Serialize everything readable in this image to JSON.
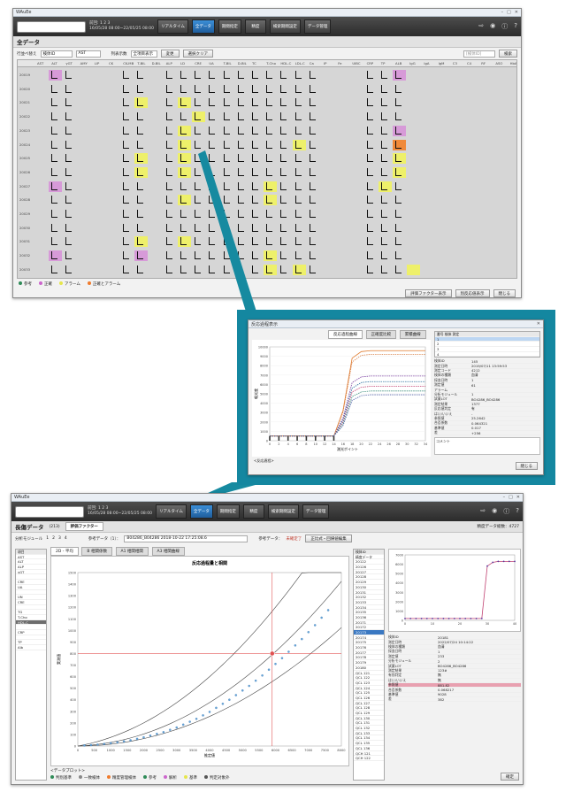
{
  "app": {
    "title": "WAuEe",
    "toolbar": {
      "date_line1": "前回: 1 2 3",
      "date_line2": "16/05/28 08:00~22/05/25 08:00",
      "buttons": [
        "リアルタイム",
        "全データ",
        "期間指定",
        "精度",
        "検索期間設定",
        "データ管理"
      ],
      "icons": [
        "exit-icon",
        "camera-icon",
        "info-icon",
        "help-icon"
      ]
    }
  },
  "top_window": {
    "section_title": "全データ",
    "controls": {
      "sort_label": "行並べ替え",
      "sort_value": "検体ID",
      "sort_sub": "AST",
      "display_label": "列表示数",
      "display_value": "全項目表示",
      "change_button": "変更",
      "clear_button": "選択クリア",
      "search_placeholder": "[検体ID]",
      "search_button": "検索"
    },
    "columns": [
      "AST",
      "ALT",
      "γGT",
      "AMY",
      "LIP",
      "CK",
      "CK-MB",
      "T-BIL",
      "D-BIL",
      "ALP",
      "LD",
      "CRE",
      "UA",
      "T-BIL",
      "D-BIL",
      "TC",
      "T-Cho",
      "HDL-C",
      "LDL-C",
      "Ca",
      "IP",
      "Fe",
      "UIBC",
      "CRP",
      "TP",
      "ALB",
      "IgG",
      "IgA",
      "IgM",
      "C3",
      "C4",
      "RF",
      "ASO",
      "HbA1c"
    ],
    "rows": [
      "20019",
      "20020",
      "20021",
      "20022",
      "20023",
      "20024",
      "20025",
      "20026",
      "20027",
      "20028",
      "20029",
      "20030",
      "20031",
      "20032",
      "20033"
    ],
    "legend": [
      "参考",
      "正確",
      "アラーム",
      "正確とアラーム"
    ],
    "bottom_buttons": [
      "評価ファクター表示",
      "別反応値表示",
      "閉じる"
    ]
  },
  "popup": {
    "title": "反応過程表示",
    "tabs": [
      "反応過程曲線",
      "正確度比較",
      "累積曲線"
    ],
    "chart_title": "",
    "xlabel": "測光ポイント",
    "ylabel": "吸光度",
    "curve_note": "<反応過程>",
    "close_button": "閉じる",
    "fields": [
      [
        "検体ID",
        "145"
      ],
      [
        "測定日時",
        "2019/07/11 13:59:53"
      ],
      [
        "測定コード",
        "4212"
      ],
      [
        "検体の種類",
        "血清"
      ],
      [
        "採血日時",
        "1"
      ],
      [
        "測定値",
        "61"
      ],
      [
        "アラーム",
        ""
      ],
      [
        "分析モジュール",
        "1"
      ],
      [
        "試薬LOT",
        "BO4286_BO4286"
      ],
      [
        "測定結果",
        "1377"
      ],
      [
        "反応値判定",
        "有"
      ],
      [
        "はい/いいえ",
        "-"
      ],
      [
        "参照値",
        "25.2642"
      ],
      [
        "合否係数",
        "0.064321"
      ],
      [
        "基準値",
        "0.017"
      ],
      [
        "差",
        "+256"
      ]
    ],
    "list_header": [
      "番号",
      "検体",
      "測定"
    ],
    "list_items": [
      "1",
      "2",
      "3",
      "4",
      "5",
      "6",
      "7",
      "8",
      "9",
      "10",
      "11",
      "12"
    ],
    "comment_label": "コメント",
    "ok_button": "確定"
  },
  "bottom_window": {
    "section_title": "長傷データ",
    "count_label": "(213)",
    "tab_label": "評価ファクター",
    "right_info": "精度データ総数：4727",
    "module_label": "分析モジュール",
    "module_values": [
      "1",
      "2",
      "3",
      "4"
    ],
    "ref_label": "参考データ（1）：",
    "ref_value": "B04286_B04286 2018-10-22 17:25:08.6",
    "ref_status_label": "参考データ：",
    "ref_status": "未確定了",
    "register_button": "正比式・回帰値編集",
    "items_header": "項目",
    "items": [
      "AST",
      "ALT",
      "ALP",
      "γGT",
      "",
      "CRE",
      "UA",
      "",
      "UN",
      "CRE",
      "",
      "TG",
      "T-Cho",
      "HDL-C",
      "",
      "CRP",
      "",
      "TP",
      "Alb"
    ],
    "graph_tabs": [
      "2D - 平均",
      "B 相関係数",
      "A1 相関相関",
      "A3 相関曲線"
    ],
    "graph_title": "反応過程量と相関",
    "x_axis_label": "推定値",
    "y_axis_label": "実測値",
    "x_ticks": [
      "0",
      "500",
      "1000",
      "1500",
      "2000",
      "2500",
      "3000",
      "3500",
      "4000",
      "4500",
      "5000",
      "5500",
      "6000",
      "6500",
      "7000",
      "7500",
      "8000"
    ],
    "y_ticks": [
      "0",
      "100",
      "200",
      "300",
      "400",
      "500",
      "600",
      "700",
      "800",
      "900",
      "1000",
      "1100",
      "1200",
      "1300",
      "1400",
      "1500"
    ],
    "bottom_note": "<データプロット>",
    "bottom_legend": [
      "判別基準",
      "一致検体",
      "精度管理検体",
      "参考",
      "解析",
      "基準",
      "判定対象外"
    ],
    "sample_list_header": "検体ID",
    "sample_list_filter": "精度データ",
    "sample_ids": [
      "20122",
      "20126",
      "20127",
      "20128",
      "20129",
      "20130",
      "20131",
      "20132",
      "20133",
      "20134",
      "20135",
      "20136",
      "20171",
      "20172",
      "20173",
      "20174",
      "20175",
      "20176",
      "20177",
      "20178",
      "20179",
      "20180",
      "QCL 121",
      "QCL 122",
      "QCL 123",
      "QCL 124",
      "QCL 125",
      "QCL 126",
      "QCL 127",
      "QCL 128",
      "QCL 129",
      "QCL 130",
      "QCL 131",
      "QCL 132",
      "QCL 133",
      "QCL 134",
      "QCL 135",
      "QCL 136",
      "QCH 121",
      "QCH 122"
    ],
    "right_fields": [
      [
        "検体ID",
        "20181"
      ],
      [
        "測定日時",
        "2022/07/24 10:14:22"
      ],
      [
        "検体の種類",
        "血清"
      ],
      [
        "採血日時",
        "1"
      ],
      [
        "測定値",
        "233"
      ],
      [
        "分析モジュール",
        "2"
      ],
      [
        "試薬LOT",
        "BO4286_BO4286"
      ],
      [
        "測定結果",
        "123#"
      ],
      [
        "有効判定",
        "無"
      ],
      [
        "はい/いいえ",
        "無"
      ],
      [
        "参照値",
        "881.82"
      ],
      [
        "合否係数",
        "0.068217"
      ],
      [
        "基準値",
        "9028"
      ],
      [
        "差",
        "382"
      ]
    ],
    "confirm_button": "確定"
  },
  "chart_data": [
    {
      "type": "line",
      "title": "",
      "xlabel": "測光ポイント",
      "ylabel": "吸光度",
      "x": [
        0,
        2,
        4,
        6,
        8,
        10,
        12,
        14,
        16,
        18,
        20,
        22,
        24,
        26,
        28,
        30,
        32,
        34
      ],
      "series": [
        {
          "values": [
            500,
            500,
            500,
            500,
            500,
            500,
            500,
            500,
            3200,
            8800,
            9500,
            9600,
            9600,
            9600,
            9600,
            9600,
            9600,
            9600
          ]
        },
        {
          "values": [
            500,
            500,
            500,
            500,
            500,
            500,
            500,
            500,
            3000,
            8400,
            9100,
            9200,
            9200,
            9200,
            9200,
            9200,
            9200,
            9200
          ]
        },
        {
          "values": [
            500,
            500,
            500,
            500,
            500,
            500,
            500,
            500,
            2400,
            6200,
            6800,
            6900,
            6900,
            6900,
            6900,
            6900,
            6900,
            6900
          ]
        },
        {
          "values": [
            500,
            500,
            500,
            500,
            500,
            500,
            500,
            500,
            2200,
            5600,
            6200,
            6300,
            6300,
            6300,
            6300,
            6300,
            6300,
            6300
          ]
        },
        {
          "values": [
            500,
            500,
            500,
            500,
            500,
            500,
            500,
            500,
            2000,
            5200,
            5700,
            5800,
            5800,
            5800,
            5800,
            5800,
            5800,
            5800
          ]
        },
        {
          "values": [
            500,
            500,
            500,
            500,
            500,
            500,
            500,
            500,
            1800,
            4700,
            5200,
            5300,
            5300,
            5300,
            5300,
            5300,
            5300,
            5300
          ]
        },
        {
          "values": [
            500,
            500,
            500,
            500,
            500,
            500,
            500,
            500,
            1600,
            4300,
            4800,
            4900,
            4900,
            4900,
            4900,
            4900,
            4900,
            4900
          ]
        }
      ],
      "ylim": [
        0,
        10000
      ],
      "xlim": [
        0,
        34
      ]
    },
    {
      "type": "scatter",
      "xlabel": "推定値",
      "ylabel": "実測値",
      "xlim": [
        0,
        8000
      ],
      "ylim": [
        0,
        1500
      ],
      "x": [
        200,
        400,
        600,
        800,
        1000,
        1200,
        1400,
        1600,
        1800,
        2000,
        2200,
        2400,
        2600,
        2800,
        3000,
        3200,
        3400,
        3600,
        3800,
        4000,
        4200,
        4400,
        4600,
        4800,
        5000,
        5200,
        5400,
        5600,
        5800,
        6000,
        6200,
        6400,
        6600,
        6800,
        7000,
        7200,
        7400,
        7600
      ],
      "y": [
        5,
        8,
        12,
        18,
        25,
        32,
        40,
        50,
        62,
        75,
        90,
        105,
        120,
        140,
        160,
        185,
        210,
        235,
        265,
        295,
        330,
        365,
        400,
        440,
        480,
        520,
        565,
        610,
        660,
        710,
        760,
        815,
        870,
        925,
        985,
        1045,
        1110,
        1175
      ],
      "marker": {
        "x": 5900,
        "y": 800
      }
    },
    {
      "type": "line",
      "x": [
        0,
        2,
        4,
        6,
        8,
        10,
        12,
        14,
        16,
        18,
        20,
        22,
        24,
        26,
        28,
        30,
        32,
        34,
        36,
        38,
        40
      ],
      "series": [
        {
          "values": [
            200,
            200,
            200,
            200,
            200,
            200,
            200,
            200,
            200,
            200,
            200,
            200,
            200,
            200,
            200,
            5800,
            6200,
            6300,
            6300,
            6300,
            6300
          ]
        }
      ],
      "ylim": [
        0,
        7000
      ]
    }
  ]
}
